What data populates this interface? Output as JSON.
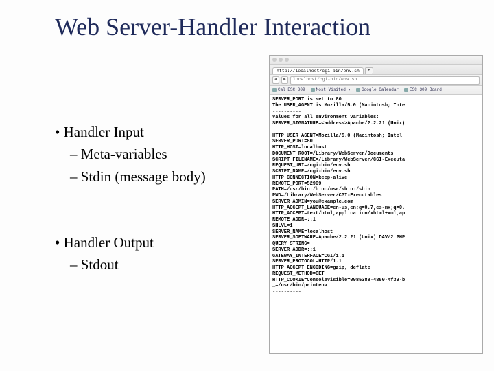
{
  "title": "Web Server-Handler Interaction",
  "left": {
    "group1_head": "Handler Input",
    "group1_sub1": "Meta-variables",
    "group1_sub2": "Stdin  (message body)",
    "group2_head": "Handler Output",
    "group2_sub1": "Stdout"
  },
  "browser": {
    "tab_label": "http://localhost/cgi-bin/env.sh",
    "tab_plus": "+",
    "nav_back": "◄",
    "nav_fwd": "►",
    "url": "localhost/cgi-bin/env.sh",
    "bookmarks": {
      "b1": "Cal ESC 309",
      "b2": "Most Visited ▾",
      "b3": "Google Calendar",
      "b4": "ESC 309 Board"
    },
    "content_lines": [
      "SERVER_PORT is set to 80",
      "The USER_AGENT is Mozilla/5.0 (Macintosh; Inte",
      "----------",
      "Values for all environment variables:",
      "SERVER_SIGNATURE=<address>Apache/2.2.21 (Unix)",
      "",
      "HTTP_USER_AGENT=Mozilla/5.0 (Macintosh; Intel",
      "SERVER_PORT=80",
      "HTTP_HOST=localhost",
      "DOCUMENT_ROOT=/Library/WebServer/Documents",
      "SCRIPT_FILENAME=/Library/WebServer/CGI-Executa",
      "REQUEST_URI=/cgi-bin/env.sh",
      "SCRIPT_NAME=/cgi-bin/env.sh",
      "HTTP_CONNECTION=keep-alive",
      "REMOTE_PORT=52909",
      "PATH=/usr/bin:/bin:/usr/sbin:/sbin",
      "PWD=/Library/WebServer/CGI-Executables",
      "SERVER_ADMIN=you@example.com",
      "HTTP_ACCEPT_LANGUAGE=en-us,en;q=0.7,es-mx;q=0.",
      "HTTP_ACCEPT=text/html,application/xhtml+xml,ap",
      "REMOTE_ADDR=::1",
      "SHLVL=1",
      "SERVER_NAME=localhost",
      "SERVER_SOFTWARE=Apache/2.2.21 (Unix) DAV/2 PHP",
      "QUERY_STRING=",
      "SERVER_ADDR=::1",
      "GATEWAY_INTERFACE=CGI/1.1",
      "SERVER_PROTOCOL=HTTP/1.1",
      "HTTP_ACCEPT_ENCODING=gzip, deflate",
      "REQUEST_METHOD=GET",
      "HTTP_COOKIE=ConsoleVisible=0985388-4850-4f39-b",
      "_=/usr/bin/printenv",
      "----------"
    ]
  }
}
